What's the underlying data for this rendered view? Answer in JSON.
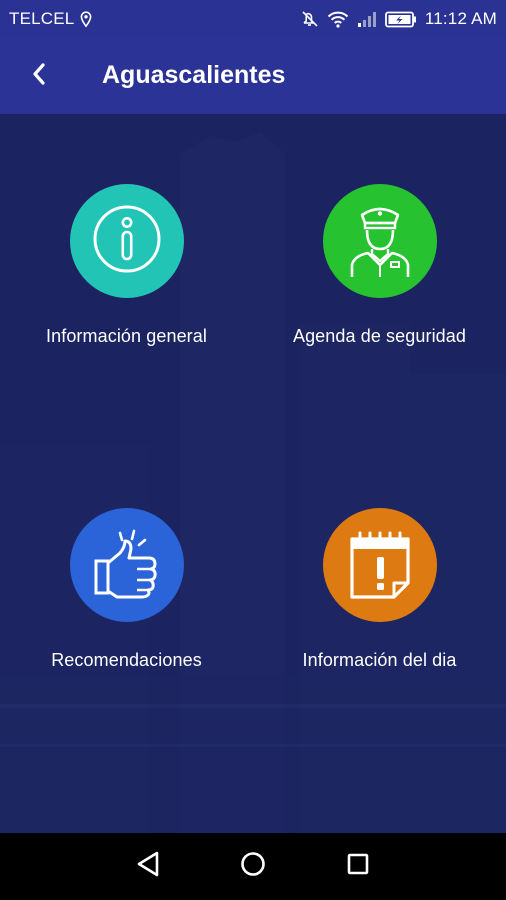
{
  "status_bar": {
    "carrier": "TELCEL",
    "time": "11:12 AM",
    "icons": [
      "location-pin-icon",
      "mute-icon",
      "wifi-icon",
      "signal-icon",
      "battery-charging-icon"
    ]
  },
  "app_bar": {
    "title": "Aguascalientes",
    "back_icon": "chevron-left-icon"
  },
  "menu": {
    "items": [
      {
        "label": "Información general",
        "icon": "info-icon",
        "color": "#22c4b6"
      },
      {
        "label": "Agenda de seguridad",
        "icon": "police-officer-icon",
        "color": "#27c22f"
      },
      {
        "label": "Recomendaciones",
        "icon": "thumbs-up-icon",
        "color": "#2b63d8"
      },
      {
        "label": "Información del dia",
        "icon": "calendar-alert-icon",
        "color": "#de7a12"
      }
    ]
  },
  "nav_bar": {
    "icons": [
      "back-triangle-icon",
      "home-circle-icon",
      "recents-square-icon"
    ]
  },
  "colors": {
    "app_bar": "#2b3396",
    "background": "#1c2561"
  }
}
